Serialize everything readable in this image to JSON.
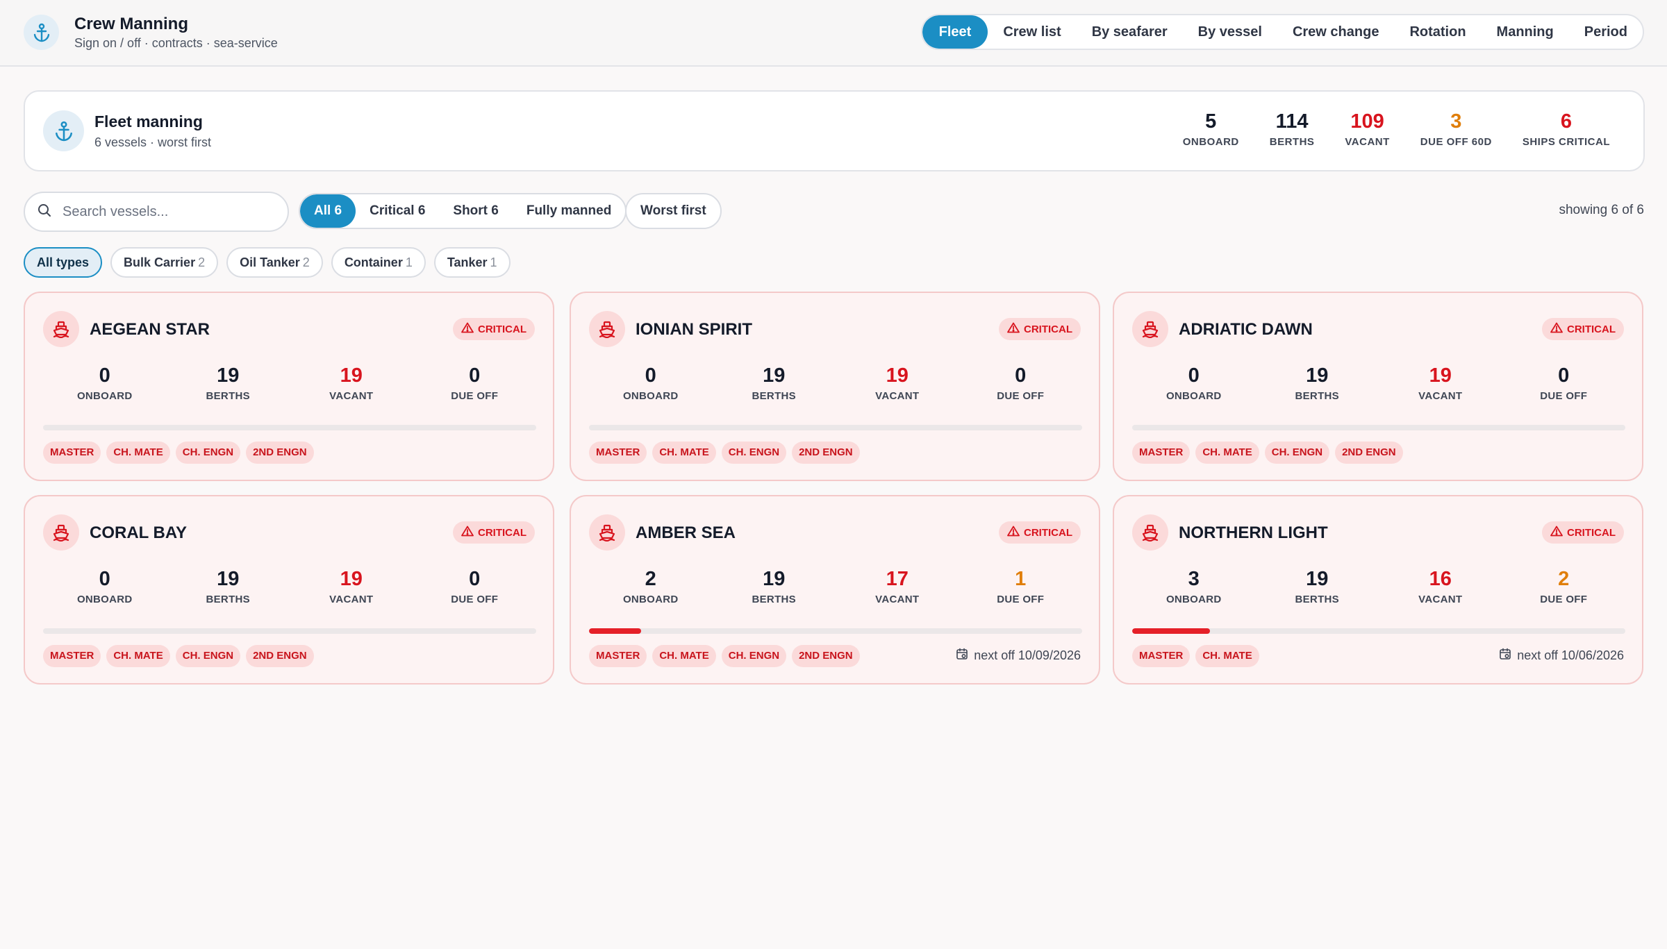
{
  "app": {
    "title": "Crew Manning",
    "subtitle": "Sign on / off · contracts · sea-service",
    "icon": "anchor-icon"
  },
  "nav": {
    "tabs": [
      {
        "label": "Fleet",
        "active": true
      },
      {
        "label": "Crew list"
      },
      {
        "label": "By seafarer"
      },
      {
        "label": "By vessel"
      },
      {
        "label": "Crew change"
      },
      {
        "label": "Rotation"
      },
      {
        "label": "Manning"
      },
      {
        "label": "Period"
      }
    ]
  },
  "summary": {
    "title": "Fleet manning",
    "subtitle": "6 vessels · worst first",
    "stats": [
      {
        "value": "5",
        "label": "ONBOARD",
        "color": "#141b2a"
      },
      {
        "value": "114",
        "label": "BERTHS",
        "color": "#141b2a"
      },
      {
        "value": "109",
        "label": "VACANT",
        "color": "#d8141e"
      },
      {
        "value": "3",
        "label": "DUE OFF 60D",
        "color": "#e07e0a"
      },
      {
        "value": "6",
        "label": "SHIPS CRITICAL",
        "color": "#d8141e"
      }
    ]
  },
  "filters": {
    "search_placeholder": "Search vessels...",
    "segments": [
      {
        "label": "All 6",
        "active": true
      },
      {
        "label": "Critical 6"
      },
      {
        "label": "Short 6"
      },
      {
        "label": "Fully manned"
      }
    ],
    "sort_label": "Worst first",
    "showing": "showing 6 of 6",
    "types": [
      {
        "label": "All types",
        "count": "",
        "active": true
      },
      {
        "label": "Bulk Carrier",
        "count": "2"
      },
      {
        "label": "Oil Tanker",
        "count": "2"
      },
      {
        "label": "Container",
        "count": "1"
      },
      {
        "label": "Tanker",
        "count": "1"
      }
    ]
  },
  "vessels": [
    {
      "name": "AEGEAN STAR",
      "status": "CRITICAL",
      "onboard": "0",
      "berths": "19",
      "vacant": "19",
      "due_off": "0",
      "fill": 0,
      "roles": [
        "MASTER",
        "CH. MATE",
        "CH. ENGN",
        "2ND ENGN"
      ],
      "next_off": ""
    },
    {
      "name": "IONIAN SPIRIT",
      "status": "CRITICAL",
      "onboard": "0",
      "berths": "19",
      "vacant": "19",
      "due_off": "0",
      "fill": 0,
      "roles": [
        "MASTER",
        "CH. MATE",
        "CH. ENGN",
        "2ND ENGN"
      ],
      "next_off": ""
    },
    {
      "name": "ADRIATIC DAWN",
      "status": "CRITICAL",
      "onboard": "0",
      "berths": "19",
      "vacant": "19",
      "due_off": "0",
      "fill": 0,
      "roles": [
        "MASTER",
        "CH. MATE",
        "CH. ENGN",
        "2ND ENGN"
      ],
      "next_off": ""
    },
    {
      "name": "CORAL BAY",
      "status": "CRITICAL",
      "onboard": "0",
      "berths": "19",
      "vacant": "19",
      "due_off": "0",
      "fill": 0,
      "roles": [
        "MASTER",
        "CH. MATE",
        "CH. ENGN",
        "2ND ENGN"
      ],
      "next_off": ""
    },
    {
      "name": "AMBER SEA",
      "status": "CRITICAL",
      "onboard": "2",
      "berths": "19",
      "vacant": "17",
      "due_off": "1",
      "fill": 0.105,
      "roles": [
        "MASTER",
        "CH. MATE",
        "CH. ENGN",
        "2ND ENGN"
      ],
      "next_off": "next off 10/09/2026"
    },
    {
      "name": "NORTHERN LIGHT",
      "status": "CRITICAL",
      "onboard": "3",
      "berths": "19",
      "vacant": "16",
      "due_off": "2",
      "fill": 0.158,
      "roles": [
        "MASTER",
        "CH. MATE"
      ],
      "next_off": "next off 10/06/2026"
    }
  ],
  "labels": {
    "onboard": "ONBOARD",
    "berths": "BERTHS",
    "vacant": "VACANT",
    "due_off": "DUE OFF"
  },
  "colors": {
    "accent": "#1b8ec4",
    "critical": "#d8141e",
    "warning": "#e07e0a"
  }
}
